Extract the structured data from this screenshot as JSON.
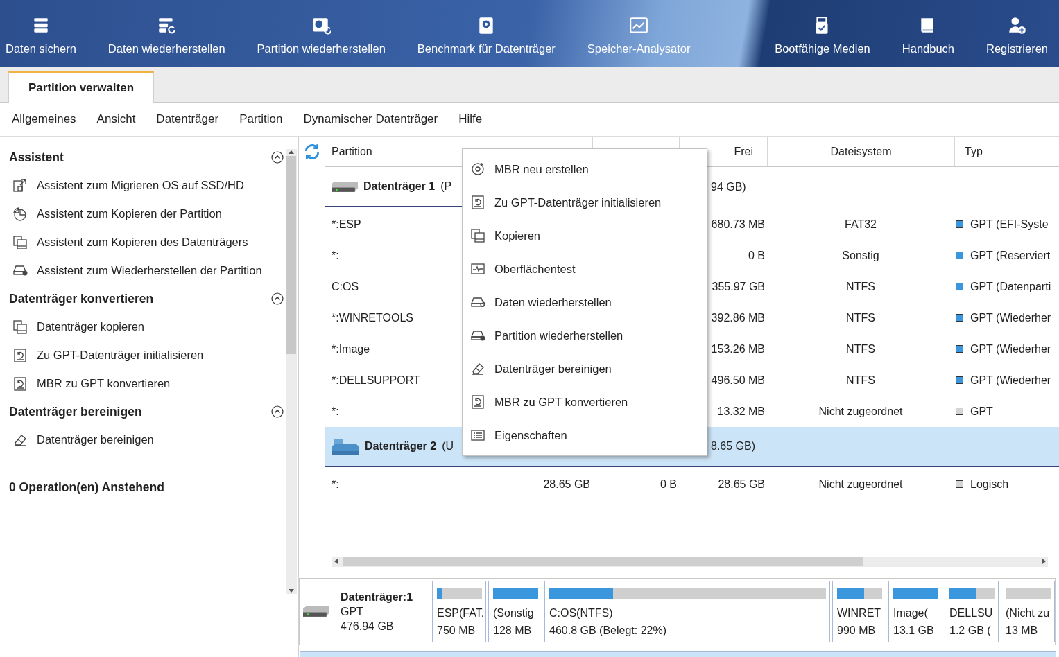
{
  "toolbar": {
    "left": [
      {
        "label": "Daten sichern"
      },
      {
        "label": "Daten wiederherstellen"
      },
      {
        "label": "Partition wiederherstellen"
      },
      {
        "label": "Benchmark für Datenträger"
      },
      {
        "label": "Speicher-Analysator"
      }
    ],
    "right": [
      {
        "label": "Bootfähige Medien"
      },
      {
        "label": "Handbuch"
      },
      {
        "label": "Registrieren"
      }
    ]
  },
  "tabs": [
    {
      "label": "Partition verwalten",
      "selected": true
    }
  ],
  "menu": [
    "Allgemeines",
    "Ansicht",
    "Datenträger",
    "Partition",
    "Dynamischer Datenträger",
    "Hilfe"
  ],
  "sidebar": {
    "sections": [
      {
        "title": "Assistent",
        "expanded": true,
        "items": [
          {
            "label": "Assistent zum Migrieren OS auf SSD/HD"
          },
          {
            "label": "Assistent zum Kopieren der Partition"
          },
          {
            "label": "Assistent zum Kopieren des Datenträgers"
          },
          {
            "label": "Assistent zum Wiederherstellen der Partition"
          }
        ]
      },
      {
        "title": "Datenträger konvertieren",
        "expanded": true,
        "items": [
          {
            "label": "Datenträger kopieren"
          },
          {
            "label": "Zu GPT-Datenträger initialisieren"
          },
          {
            "label": "MBR zu GPT konvertieren"
          }
        ]
      },
      {
        "title": "Datenträger bereinigen",
        "expanded": true,
        "items": [
          {
            "label": "Datenträger bereinigen"
          }
        ]
      }
    ],
    "pending": "0 Operation(en) Anstehend"
  },
  "table": {
    "columns": {
      "partition": "Partition",
      "free": "Frei",
      "filesystem": "Dateisystem",
      "type": "Typ"
    },
    "rows": [
      {
        "kind": "disk",
        "name": "Datenträger 1",
        "info_start": "(P",
        "info_end": "94 GB)",
        "selected": false
      },
      {
        "kind": "partition",
        "name": "*:ESP",
        "free": "680.73 MB",
        "filesystem": "FAT32",
        "type": "GPT (EFI-Syste",
        "color": "#3a96dd"
      },
      {
        "kind": "partition",
        "name": "*:",
        "free": "0 B",
        "filesystem": "Sonstig",
        "type": "GPT (Reserviert",
        "color": "#3a96dd"
      },
      {
        "kind": "partition",
        "name": "C:OS",
        "free": "355.97 GB",
        "filesystem": "NTFS",
        "type": "GPT (Datenparti",
        "color": "#3a96dd"
      },
      {
        "kind": "partition",
        "name": "*:WINRETOOLS",
        "free": "392.86 MB",
        "filesystem": "NTFS",
        "type": "GPT (Wiederher",
        "color": "#3a96dd"
      },
      {
        "kind": "partition",
        "name": "*:Image",
        "free": "153.26 MB",
        "filesystem": "NTFS",
        "type": "GPT (Wiederher",
        "color": "#3a96dd"
      },
      {
        "kind": "partition",
        "name": "*:DELLSUPPORT",
        "free": "496.50 MB",
        "filesystem": "NTFS",
        "type": "GPT (Wiederher",
        "color": "#3a96dd"
      },
      {
        "kind": "partition",
        "name": "*:",
        "free": "13.32 MB",
        "filesystem": "Nicht zugeordnet",
        "type": "GPT",
        "color": "#d4d4d4"
      },
      {
        "kind": "disk",
        "name": "Datenträger 2",
        "info_start": "(U",
        "info_end": "8.65 GB)",
        "selected": true
      },
      {
        "kind": "partition",
        "name": "*:",
        "capacity": "28.65 GB",
        "used": "0 B",
        "free": "28.65 GB",
        "filesystem": "Nicht zugeordnet",
        "type": "Logisch",
        "color": "#d4d4d4"
      }
    ]
  },
  "context_menu": [
    "MBR neu erstellen",
    "Zu GPT-Datenträger initialisieren",
    "Kopieren",
    "Oberflächentest",
    "Daten wiederherstellen",
    "Partition wiederherstellen",
    "Datenträger bereinigen",
    "MBR zu GPT konvertieren",
    "Eigenschaften"
  ],
  "disk_map": {
    "name": "Datenträger:1",
    "scheme": "GPT",
    "size": "476.94 GB",
    "partitions": [
      {
        "label": "ESP(FAT.",
        "size": "750 MB",
        "level": 0.1
      },
      {
        "label": "(Sonstig",
        "size": "128 MB",
        "level": 1
      },
      {
        "label": "C:OS(NTFS)",
        "size": "460.8 GB (Belegt: 22%)",
        "level": 0.23
      },
      {
        "label": "WINRET",
        "size": "990 MB",
        "level": 0.6
      },
      {
        "label": "Image(",
        "size": "13.1 GB",
        "level": 1
      },
      {
        "label": "DELLSU",
        "size": "1.2 GB (",
        "level": 0.6
      },
      {
        "label": "(Nicht zu",
        "size": "13 MB",
        "level": 0
      }
    ]
  }
}
